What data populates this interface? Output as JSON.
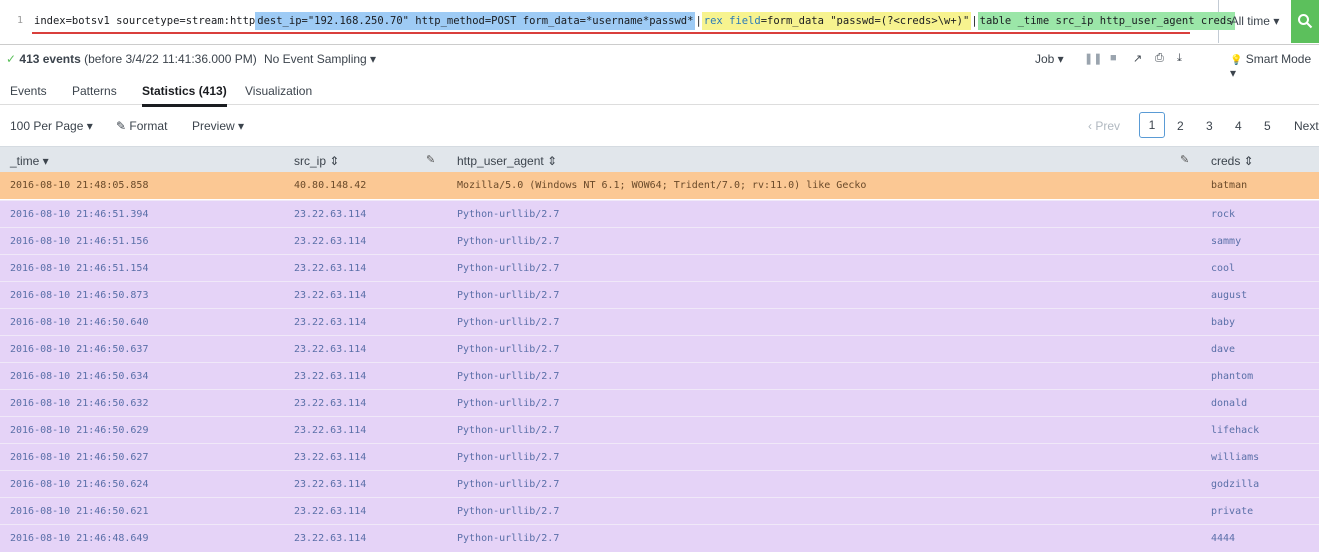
{
  "search": {
    "line_number": "1",
    "query_plain": "index=botsv1 sourcetype=stream:http ",
    "query_hl1": "dest_ip=\"192.168.250.70\" http_method=POST form_data=*username*passwd*",
    "pipe1": " | ",
    "query_rex_kw": "rex",
    "query_rex_field": "field",
    "query_rex_rest": "=form_data \"passwd=(?<creds>\\w+)\"",
    "pipe2": " | ",
    "query_table": "table _time src_ip http_user_agent creds"
  },
  "time_picker": {
    "label": "All time ▾"
  },
  "status": {
    "check": "✓",
    "count": "413 events",
    "before": "(before 3/4/22 11:41:36.000 PM)",
    "sampling": "No Event Sampling ▾",
    "job": "Job ▾",
    "smart_mode": "Smart Mode ▾"
  },
  "tabs": [
    "Events",
    "Patterns",
    "Statistics (413)",
    "Visualization"
  ],
  "controls": {
    "per_page": "100 Per Page ▾",
    "format": "Format",
    "preview": "Preview ▾",
    "prev": "‹ Prev",
    "pages": [
      "1",
      "2",
      "3",
      "4",
      "5"
    ],
    "next": "Next"
  },
  "table": {
    "headers": [
      "_time ▾",
      "src_ip ⇕",
      "http_user_agent ⇕",
      "creds ⇕"
    ],
    "rows": [
      [
        "2016-08-10 21:48:05.858",
        "40.80.148.42",
        "Mozilla/5.0 (Windows NT 6.1; WOW64; Trident/7.0; rv:11.0) like Gecko",
        "batman"
      ],
      [
        "2016-08-10 21:46:51.394",
        "23.22.63.114",
        "Python-urllib/2.7",
        "rock"
      ],
      [
        "2016-08-10 21:46:51.156",
        "23.22.63.114",
        "Python-urllib/2.7",
        "sammy"
      ],
      [
        "2016-08-10 21:46:51.154",
        "23.22.63.114",
        "Python-urllib/2.7",
        "cool"
      ],
      [
        "2016-08-10 21:46:50.873",
        "23.22.63.114",
        "Python-urllib/2.7",
        "august"
      ],
      [
        "2016-08-10 21:46:50.640",
        "23.22.63.114",
        "Python-urllib/2.7",
        "baby"
      ],
      [
        "2016-08-10 21:46:50.637",
        "23.22.63.114",
        "Python-urllib/2.7",
        "dave"
      ],
      [
        "2016-08-10 21:46:50.634",
        "23.22.63.114",
        "Python-urllib/2.7",
        "phantom"
      ],
      [
        "2016-08-10 21:46:50.632",
        "23.22.63.114",
        "Python-urllib/2.7",
        "donald"
      ],
      [
        "2016-08-10 21:46:50.629",
        "23.22.63.114",
        "Python-urllib/2.7",
        "lifehack"
      ],
      [
        "2016-08-10 21:46:50.627",
        "23.22.63.114",
        "Python-urllib/2.7",
        "williams"
      ],
      [
        "2016-08-10 21:46:50.624",
        "23.22.63.114",
        "Python-urllib/2.7",
        "godzilla"
      ],
      [
        "2016-08-10 21:46:50.621",
        "23.22.63.114",
        "Python-urllib/2.7",
        "private"
      ],
      [
        "2016-08-10 21:46:48.649",
        "23.22.63.114",
        "Python-urllib/2.7",
        "4444"
      ]
    ]
  },
  "colors": {
    "highlight_row": "#fbc894",
    "normal_row": "#e5d3f7",
    "search_button": "#5cc05c"
  }
}
